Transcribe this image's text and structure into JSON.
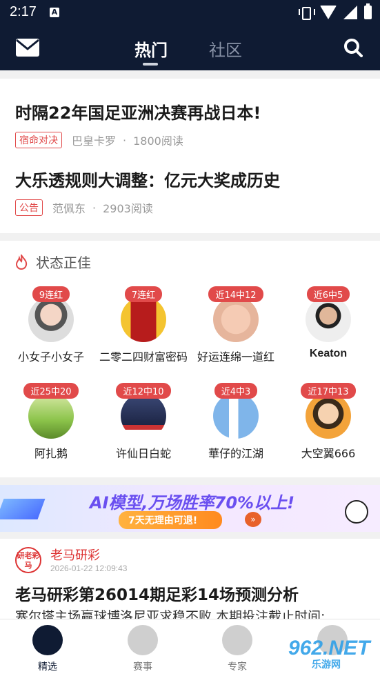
{
  "status": {
    "time": "2:17",
    "notif_icon": "A"
  },
  "header": {
    "mail_icon": "mail-icon",
    "tabs": [
      {
        "label": "热门",
        "active": true
      },
      {
        "label": "社区",
        "active": false
      }
    ],
    "search_icon": "search-icon"
  },
  "news": [
    {
      "title": "时隔22年国足亚洲决赛再战日本!",
      "tag": "宿命对决",
      "author": "巴皇卡罗",
      "reads": "1800阅读"
    },
    {
      "title": "大乐透规则大调整：亿元大奖成历史",
      "tag": "公告",
      "author": "范佩东",
      "reads": "2903阅读"
    }
  ],
  "hot": {
    "title": "状态正佳",
    "users": [
      {
        "badge": "9连红",
        "name": "小女子小女子",
        "color": "#e7c8b3"
      },
      {
        "badge": "7连红",
        "name": "二零二四财富密码",
        "color": "#b71c1c"
      },
      {
        "badge": "近14中12",
        "name": "好运连绵一道红",
        "color": "#f0c4b0"
      },
      {
        "badge": "近6中5",
        "name": "Keaton",
        "color": "#d9d9d9"
      },
      {
        "badge": "近25中20",
        "name": "阿扎鹅",
        "color": "#8bc34a"
      },
      {
        "badge": "近12中10",
        "name": "许仙日白蛇",
        "color": "#2f3b60"
      },
      {
        "badge": "近4中3",
        "name": "華仔的江湖",
        "color": "#4a90e2"
      },
      {
        "badge": "近17中13",
        "name": "大空翼666",
        "color": "#f3a33a"
      }
    ]
  },
  "banner": {
    "main": "AI模型,万场胜率70%以上!",
    "sub": "7天无理由可退!",
    "arrow": "»"
  },
  "post": {
    "avatar_text": "研老彩马",
    "author": "老马研彩",
    "time": "2026-01-22 12:09:43",
    "title": "老马研彩第26014期足彩14场预测分析",
    "summary": "塞尔塔主场赢球博洛尼亚求稳不败 本期投注截止时间:"
  },
  "bottom_nav": [
    {
      "label": "精选",
      "active": true
    },
    {
      "label": "赛事",
      "active": false
    },
    {
      "label": "专家",
      "active": false
    },
    {
      "label": "",
      "active": false
    }
  ],
  "watermark": {
    "main": "962.NET",
    "sub": "乐游网"
  },
  "colors": {
    "header_bg": "#0f1b33",
    "accent_red": "#e14a4a",
    "banner_purple": "#6a4ff0"
  }
}
